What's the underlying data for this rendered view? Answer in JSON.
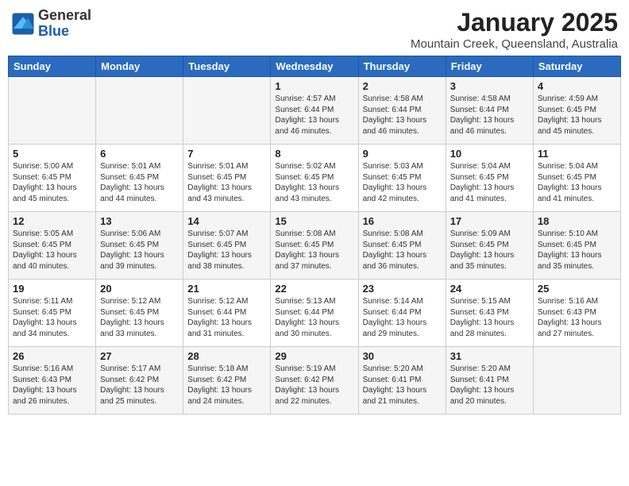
{
  "header": {
    "logo": {
      "general": "General",
      "blue": "Blue"
    },
    "month": "January 2025",
    "location": "Mountain Creek, Queensland, Australia"
  },
  "weekdays": [
    "Sunday",
    "Monday",
    "Tuesday",
    "Wednesday",
    "Thursday",
    "Friday",
    "Saturday"
  ],
  "weeks": [
    [
      {
        "day": "",
        "content": ""
      },
      {
        "day": "",
        "content": ""
      },
      {
        "day": "",
        "content": ""
      },
      {
        "day": "1",
        "content": "Sunrise: 4:57 AM\nSunset: 6:44 PM\nDaylight: 13 hours\nand 46 minutes."
      },
      {
        "day": "2",
        "content": "Sunrise: 4:58 AM\nSunset: 6:44 PM\nDaylight: 13 hours\nand 46 minutes."
      },
      {
        "day": "3",
        "content": "Sunrise: 4:58 AM\nSunset: 6:44 PM\nDaylight: 13 hours\nand 46 minutes."
      },
      {
        "day": "4",
        "content": "Sunrise: 4:59 AM\nSunset: 6:45 PM\nDaylight: 13 hours\nand 45 minutes."
      }
    ],
    [
      {
        "day": "5",
        "content": "Sunrise: 5:00 AM\nSunset: 6:45 PM\nDaylight: 13 hours\nand 45 minutes."
      },
      {
        "day": "6",
        "content": "Sunrise: 5:01 AM\nSunset: 6:45 PM\nDaylight: 13 hours\nand 44 minutes."
      },
      {
        "day": "7",
        "content": "Sunrise: 5:01 AM\nSunset: 6:45 PM\nDaylight: 13 hours\nand 43 minutes."
      },
      {
        "day": "8",
        "content": "Sunrise: 5:02 AM\nSunset: 6:45 PM\nDaylight: 13 hours\nand 43 minutes."
      },
      {
        "day": "9",
        "content": "Sunrise: 5:03 AM\nSunset: 6:45 PM\nDaylight: 13 hours\nand 42 minutes."
      },
      {
        "day": "10",
        "content": "Sunrise: 5:04 AM\nSunset: 6:45 PM\nDaylight: 13 hours\nand 41 minutes."
      },
      {
        "day": "11",
        "content": "Sunrise: 5:04 AM\nSunset: 6:45 PM\nDaylight: 13 hours\nand 41 minutes."
      }
    ],
    [
      {
        "day": "12",
        "content": "Sunrise: 5:05 AM\nSunset: 6:45 PM\nDaylight: 13 hours\nand 40 minutes."
      },
      {
        "day": "13",
        "content": "Sunrise: 5:06 AM\nSunset: 6:45 PM\nDaylight: 13 hours\nand 39 minutes."
      },
      {
        "day": "14",
        "content": "Sunrise: 5:07 AM\nSunset: 6:45 PM\nDaylight: 13 hours\nand 38 minutes."
      },
      {
        "day": "15",
        "content": "Sunrise: 5:08 AM\nSunset: 6:45 PM\nDaylight: 13 hours\nand 37 minutes."
      },
      {
        "day": "16",
        "content": "Sunrise: 5:08 AM\nSunset: 6:45 PM\nDaylight: 13 hours\nand 36 minutes."
      },
      {
        "day": "17",
        "content": "Sunrise: 5:09 AM\nSunset: 6:45 PM\nDaylight: 13 hours\nand 35 minutes."
      },
      {
        "day": "18",
        "content": "Sunrise: 5:10 AM\nSunset: 6:45 PM\nDaylight: 13 hours\nand 35 minutes."
      }
    ],
    [
      {
        "day": "19",
        "content": "Sunrise: 5:11 AM\nSunset: 6:45 PM\nDaylight: 13 hours\nand 34 minutes."
      },
      {
        "day": "20",
        "content": "Sunrise: 5:12 AM\nSunset: 6:45 PM\nDaylight: 13 hours\nand 33 minutes."
      },
      {
        "day": "21",
        "content": "Sunrise: 5:12 AM\nSunset: 6:44 PM\nDaylight: 13 hours\nand 31 minutes."
      },
      {
        "day": "22",
        "content": "Sunrise: 5:13 AM\nSunset: 6:44 PM\nDaylight: 13 hours\nand 30 minutes."
      },
      {
        "day": "23",
        "content": "Sunrise: 5:14 AM\nSunset: 6:44 PM\nDaylight: 13 hours\nand 29 minutes."
      },
      {
        "day": "24",
        "content": "Sunrise: 5:15 AM\nSunset: 6:43 PM\nDaylight: 13 hours\nand 28 minutes."
      },
      {
        "day": "25",
        "content": "Sunrise: 5:16 AM\nSunset: 6:43 PM\nDaylight: 13 hours\nand 27 minutes."
      }
    ],
    [
      {
        "day": "26",
        "content": "Sunrise: 5:16 AM\nSunset: 6:43 PM\nDaylight: 13 hours\nand 26 minutes."
      },
      {
        "day": "27",
        "content": "Sunrise: 5:17 AM\nSunset: 6:42 PM\nDaylight: 13 hours\nand 25 minutes."
      },
      {
        "day": "28",
        "content": "Sunrise: 5:18 AM\nSunset: 6:42 PM\nDaylight: 13 hours\nand 24 minutes."
      },
      {
        "day": "29",
        "content": "Sunrise: 5:19 AM\nSunset: 6:42 PM\nDaylight: 13 hours\nand 22 minutes."
      },
      {
        "day": "30",
        "content": "Sunrise: 5:20 AM\nSunset: 6:41 PM\nDaylight: 13 hours\nand 21 minutes."
      },
      {
        "day": "31",
        "content": "Sunrise: 5:20 AM\nSunset: 6:41 PM\nDaylight: 13 hours\nand 20 minutes."
      },
      {
        "day": "",
        "content": ""
      }
    ]
  ]
}
